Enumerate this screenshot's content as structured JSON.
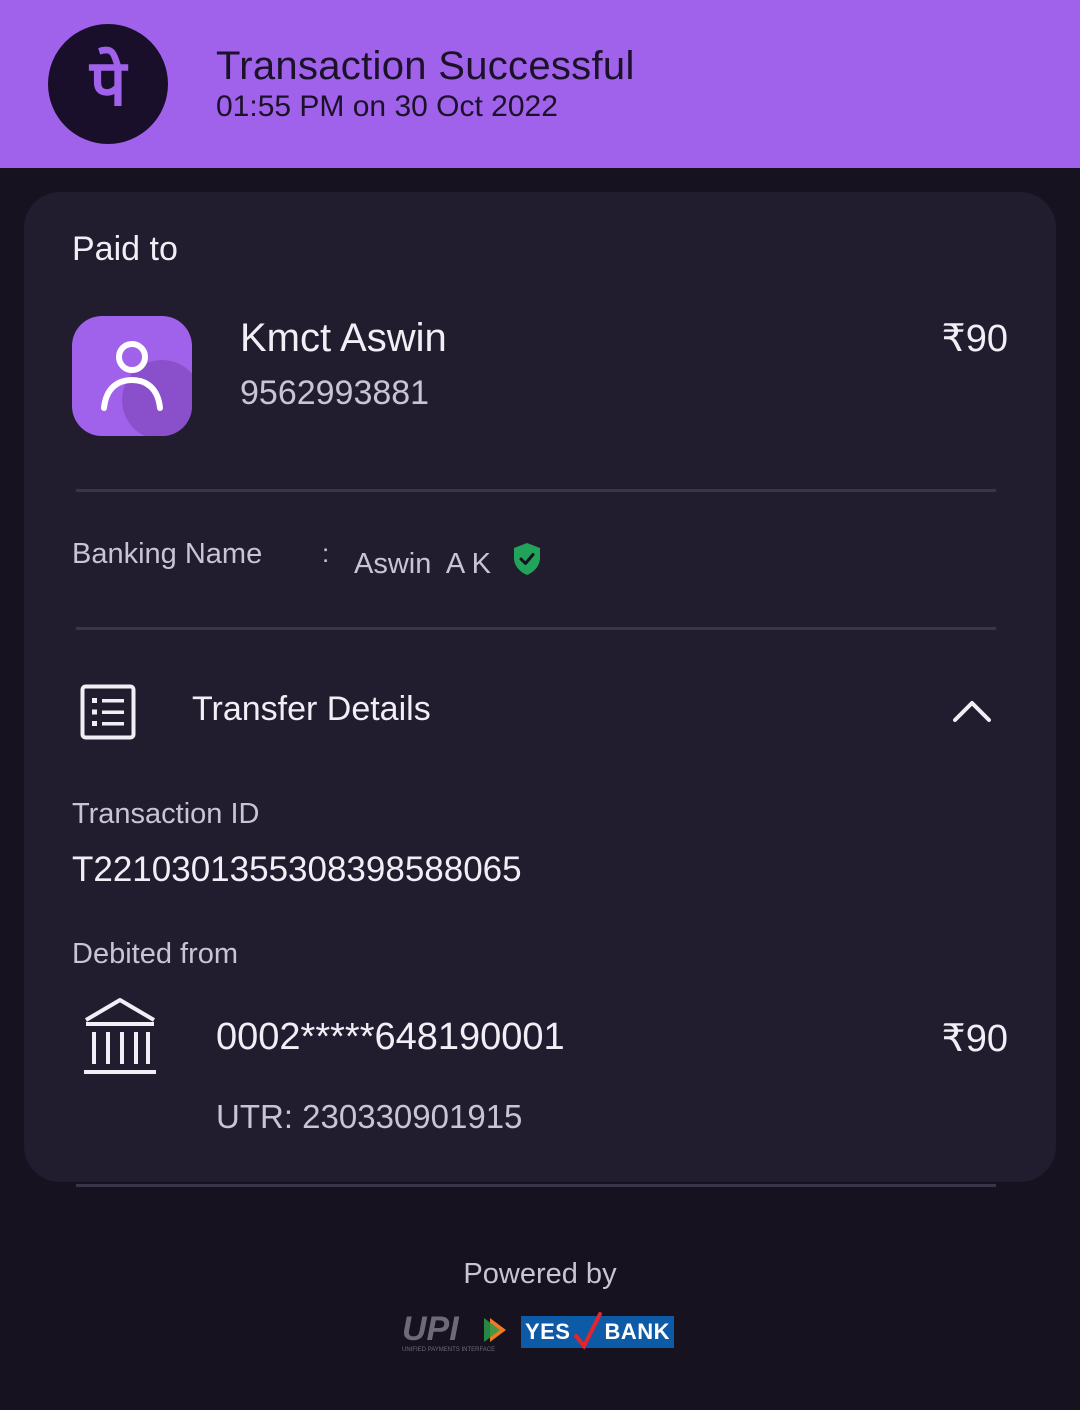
{
  "header": {
    "title": "Transaction Successful",
    "subtitle": "01:55 PM on 30 Oct 2022",
    "logo_glyph": "पे",
    "background": "#a062eb"
  },
  "payment": {
    "paid_to_label": "Paid to",
    "payee_name": "Kmct Aswin",
    "payee_phone": "9562993881",
    "amount": "₹90"
  },
  "banking": {
    "label": "Banking Name",
    "separator": ":",
    "value": "Aswin  A K",
    "verified_color": "#21a35a"
  },
  "transfer": {
    "title": "Transfer Details",
    "transaction_id_label": "Transaction ID",
    "transaction_id": "T2210301355308398588065",
    "debited_from_label": "Debited from",
    "account": "0002*****648190001",
    "amount": "₹90",
    "utr": "UTR: 230330901915"
  },
  "footer": {
    "powered_by": "Powered by",
    "upi_text": "UPI",
    "upi_caption": "UNIFIED PAYMENTS INTERFACE",
    "bank_text_1": "YES",
    "bank_text_2": "BANK"
  },
  "icons": [
    "phonepe-logo-icon",
    "person-avatar-icon",
    "verified-shield-icon",
    "list-icon",
    "chevron-up-icon",
    "bank-icon"
  ]
}
